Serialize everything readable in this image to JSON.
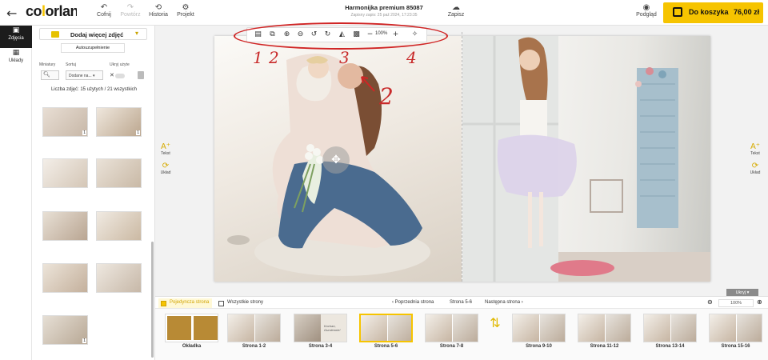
{
  "header": {
    "logo": "colorland",
    "undo": "Cofnij",
    "redo": "Powtórz",
    "history": "Historia",
    "project": "Projekt",
    "doc_title": "Harmonijka premium 85087",
    "doc_saved": "Zapisz",
    "doc_subtitle": "Zapisny zapis: 25 paź 2024, 17:23:35",
    "preview": "Podgląd",
    "cart_label": "Do koszyka",
    "cart_price": "76,00 zł"
  },
  "rail": {
    "photos": "Zdjęcia",
    "layouts": "Układy"
  },
  "panel": {
    "add_photos": "Dodaj więcej zdjęć",
    "autofill": "Autouzupełnienie",
    "thumbs_label": "Miniatury",
    "sort_label": "Sortuj",
    "hide_used_label": "Ukryj użyte",
    "sort_value": "Dodane na...",
    "photo_count": "Liczba zdjęć: 15 użytych / 21 wszystkich",
    "thumbs": [
      {
        "n": "1"
      },
      {
        "n": "1"
      },
      {
        "n": ""
      },
      {
        "n": ""
      },
      {
        "n": ""
      },
      {
        "n": ""
      },
      {
        "n": ""
      },
      {
        "n": ""
      },
      {
        "n": "1"
      }
    ]
  },
  "canvas": {
    "zoom": "100%",
    "text_label": "Tekst",
    "layout_label": "Układ",
    "hide_label": "Ukryj",
    "annotations": [
      "1",
      "2",
      "3",
      "4",
      "2"
    ]
  },
  "bottombar": {
    "single": "Pojedyncza strona",
    "all": "Wszystkie strony",
    "prev": "Poprzednia strona",
    "current": "Strona 5-6",
    "next": "Następna strona",
    "zoom": "100%"
  },
  "pages": [
    "Okładka",
    "Strona 1-2",
    "Strona 3-4",
    "Strona 5-6",
    "Strona 7-8",
    "Strona 9-10",
    "Strona 11-12",
    "Strona 13-14",
    "Strona 15-16"
  ],
  "page3_text": "Kochan, Gumiennie!",
  "colors": {
    "accent": "#f6c400",
    "annotation": "#d02525"
  }
}
